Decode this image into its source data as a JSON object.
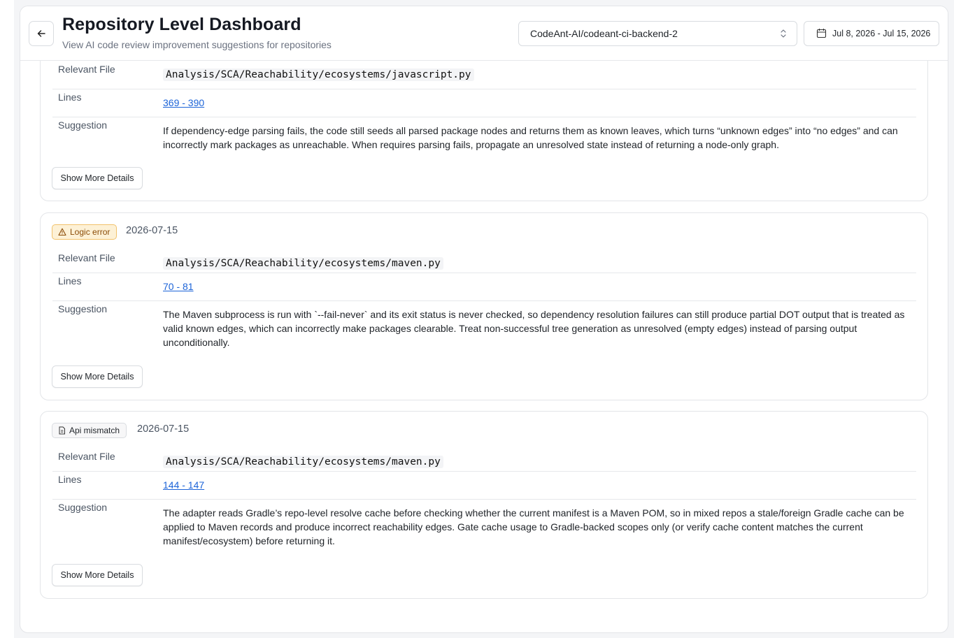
{
  "header": {
    "title": "Repository Level Dashboard",
    "subtitle": "View AI code review improvement suggestions for repositories",
    "repo_value": "CodeAnt-AI/codeant-ci-backend-2",
    "date_range": "Jul 8, 2026 - Jul 15, 2026"
  },
  "labels": {
    "relevant_file": "Relevant File",
    "lines": "Lines",
    "suggestion": "Suggestion",
    "show_more": "Show More Details"
  },
  "cards": [
    {
      "file": "Analysis/SCA/Reachability/ecosystems/javascript.py",
      "lines": "369 - 390",
      "suggestion": "If dependency-edge parsing fails, the code still seeds all parsed package nodes and returns them as known leaves, which turns “unknown edges” into “no edges” and can incorrectly mark packages as unreachable. When requires parsing fails, propagate an unresolved state instead of returning a node-only graph."
    },
    {
      "badge": "Logic error",
      "badge_icon": "warning-triangle-icon",
      "date": "2026-07-15",
      "file": "Analysis/SCA/Reachability/ecosystems/maven.py",
      "lines": "70 - 81",
      "suggestion": "The Maven subprocess is run with `--fail-never` and its exit status is never checked, so dependency resolution failures can still produce partial DOT output that is treated as valid known edges, which can incorrectly make packages clearable. Treat non-successful tree generation as unresolved (empty edges) instead of parsing output unconditionally."
    },
    {
      "badge": "Api mismatch",
      "badge_icon": "document-icon",
      "date": "2026-07-15",
      "file": "Analysis/SCA/Reachability/ecosystems/maven.py",
      "lines": "144 - 147",
      "suggestion": "The adapter reads Gradle’s repo-level resolve cache before checking whether the current manifest is a Maven POM, so in mixed repos a stale/foreign Gradle cache can be applied to Maven records and produce incorrect reachability edges. Gate cache usage to Gradle-backed scopes only (or verify cache content matches the current manifest/ecosystem) before returning it."
    }
  ],
  "colors": {
    "link": "#1d64d8",
    "warn_badge_bg": "#fdf1d6",
    "warn_badge_border": "#f1c26b"
  }
}
